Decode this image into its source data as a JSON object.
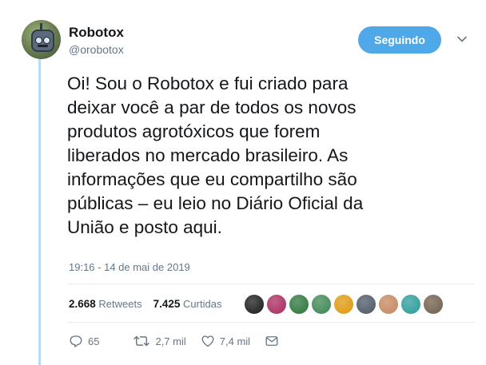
{
  "author": {
    "name": "Robotox",
    "handle": "@orobotox"
  },
  "follow_button": {
    "label": "Seguindo",
    "color": "#4fa9e8"
  },
  "tweet": {
    "lines": [
      "Oi! Sou o Robotox e fui criado para",
      "deixar você a par de todos os novos",
      "produtos agrotóxicos que forem",
      "liberados no mercado brasileiro. As",
      "informações que eu compartilho são",
      "públicas – eu leio no Diário Oficial da",
      "União e posto aqui."
    ],
    "timestamp": "19:16 - 14 de mai de 2019"
  },
  "stats": {
    "retweets_count": "2.668",
    "retweets_label": "Retweets",
    "likes_count": "7.425",
    "likes_label": "Curtidas"
  },
  "likers_avatar_colors": [
    "#2b2b2b",
    "#b03a6a",
    "#3c7f4a",
    "#4b8f5e",
    "#e0a020",
    "#5a6470",
    "#c98f6a",
    "#3aa3a0",
    "#7a6a58",
    "#a5702e"
  ],
  "actions": {
    "reply_count": "65",
    "retweet_count": "2,7 mil",
    "like_count": "7,4 mil"
  },
  "icons": {
    "reply": "reply-icon",
    "retweet": "retweet-icon",
    "like": "heart-icon",
    "dm": "envelope-icon",
    "more": "chevron-down-icon"
  }
}
